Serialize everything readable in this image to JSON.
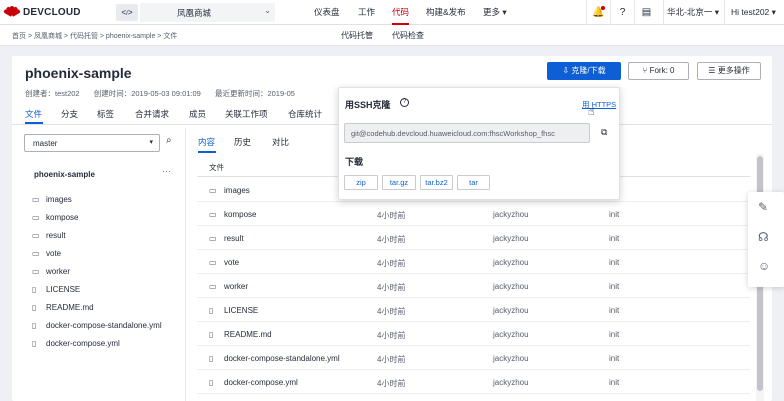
{
  "topbar": {
    "brand": "DEVCLOUD",
    "code_toggle": "<\u0018>",
    "project": "凤凰商城",
    "nav": [
      "仪表盘",
      "工作",
      "代码",
      "构建&发布",
      "更多 ▾"
    ],
    "region": "华北-北京一 ▾",
    "user": "Hi test202 ▾"
  },
  "subbar": {
    "breadcrumb": "首页 > 凤凰商城 > 代码托管 > phoenix-sample > 文件",
    "tabs": [
      "代码托管",
      "代码检查"
    ]
  },
  "repo": {
    "title": "phoenix-sample",
    "creator": "创建者：test202",
    "created": "创建时间：2019-05-03 09:01:09",
    "updated": "最近更新时间：2019-05",
    "clone_button": "克隆/下载",
    "fork_button": "Fork: 0",
    "more_button": "更多操作",
    "tabs": [
      "文件",
      "分支",
      "标签",
      "合并请求",
      "成员",
      "关联工作项",
      "仓库统计"
    ]
  },
  "sidebar": {
    "branch": "master",
    "root": "phoenix-sample",
    "more": "···",
    "items": [
      {
        "name": "images",
        "type": "folder"
      },
      {
        "name": "kompose",
        "type": "folder"
      },
      {
        "name": "result",
        "type": "folder"
      },
      {
        "name": "vote",
        "type": "folder"
      },
      {
        "name": "worker",
        "type": "folder"
      },
      {
        "name": "LICENSE",
        "type": "file"
      },
      {
        "name": "README.md",
        "type": "file"
      },
      {
        "name": "docker-compose-standalone.yml",
        "type": "file"
      },
      {
        "name": "docker-compose.yml",
        "type": "file"
      }
    ]
  },
  "content": {
    "tabs": [
      "内容",
      "历史",
      "对比"
    ],
    "header": {
      "file": "文件"
    },
    "rows": [
      {
        "name": "images",
        "type": "folder",
        "time": "",
        "author": "",
        "msg": ""
      },
      {
        "name": "kompose",
        "type": "folder",
        "time": "4小时前",
        "author": "jackyzhou",
        "msg": "init"
      },
      {
        "name": "result",
        "type": "folder",
        "time": "4小时前",
        "author": "jackyzhou",
        "msg": "init"
      },
      {
        "name": "vote",
        "type": "folder",
        "time": "4小时前",
        "author": "jackyzhou",
        "msg": "init"
      },
      {
        "name": "worker",
        "type": "folder",
        "time": "4小时前",
        "author": "jackyzhou",
        "msg": "init"
      },
      {
        "name": "LICENSE",
        "type": "file",
        "time": "4小时前",
        "author": "jackyzhou",
        "msg": "init"
      },
      {
        "name": "README.md",
        "type": "file",
        "time": "4小时前",
        "author": "jackyzhou",
        "msg": "init"
      },
      {
        "name": "docker-compose-standalone.yml",
        "type": "file",
        "time": "4小时前",
        "author": "jackyzhou",
        "msg": "init"
      },
      {
        "name": "docker-compose.yml",
        "type": "file",
        "time": "4小时前",
        "author": "jackyzhou",
        "msg": "init"
      }
    ]
  },
  "popup": {
    "title": "用SSH克隆",
    "https_link": "用 HTTPS",
    "url": "git@codehub.devcloud.huaweicloud.com:fhscWorkshop_fhsc",
    "download_title": "下载",
    "downloads": [
      "zip",
      "tar.gz",
      "tar.bz2",
      "tar"
    ]
  },
  "colors": {
    "brand": "#c7000b",
    "primary": "#0e5ed5"
  }
}
